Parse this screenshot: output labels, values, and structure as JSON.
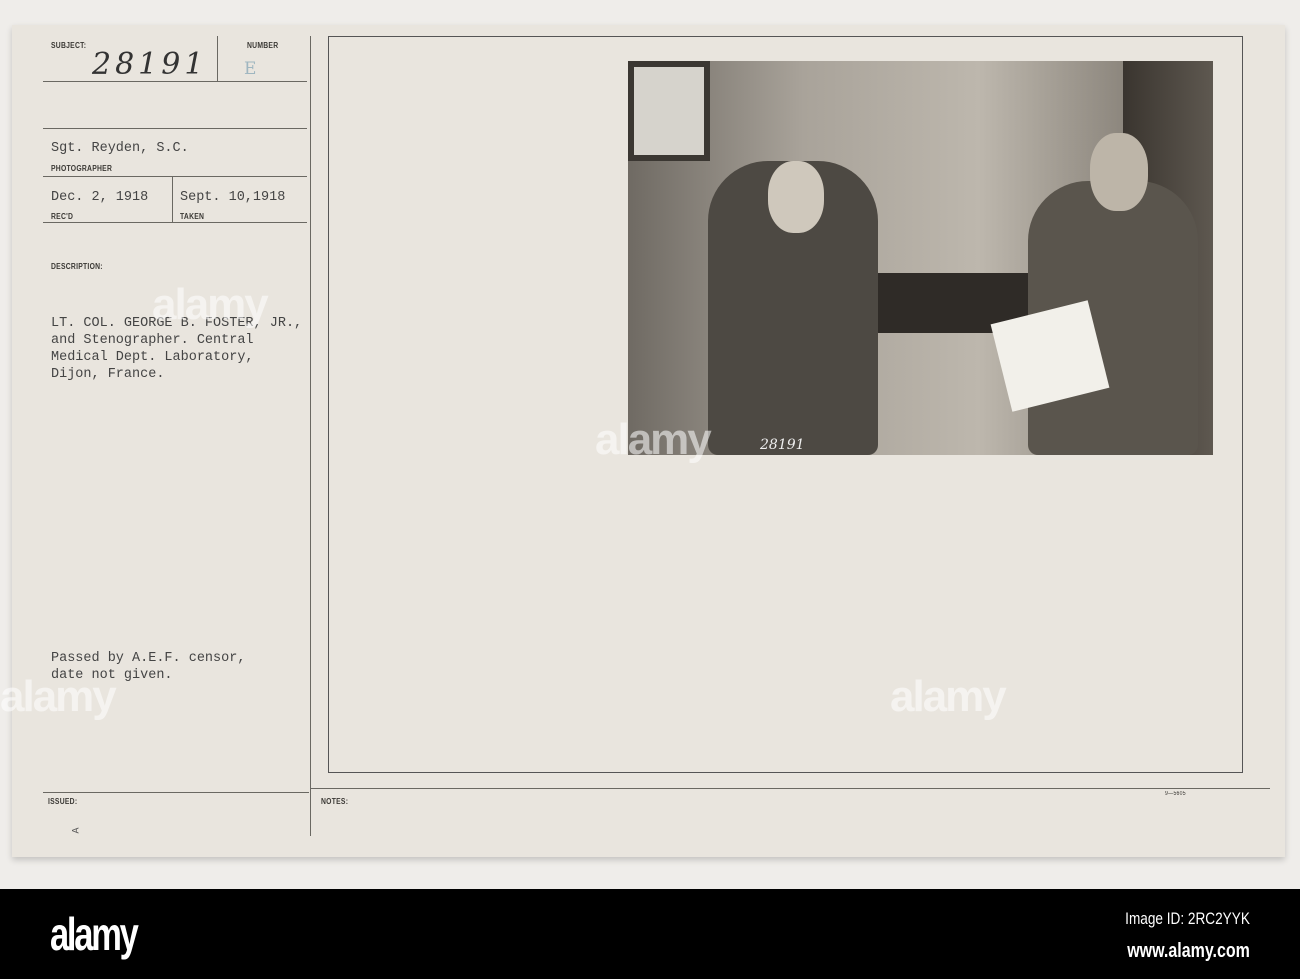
{
  "card": {
    "subject_label": "SUBJECT:",
    "subject_number": "28191",
    "number_label": "NUMBER",
    "number_value": "E",
    "photographer": "Sgt. Reyden, S.C.",
    "photographer_label": "PHOTOGRAPHER",
    "received": "Dec. 2, 1918",
    "received_label": "REC'D",
    "taken": "Sept. 10,1918",
    "taken_label": "TAKEN",
    "description_label": "DESCRIPTION:",
    "description": "LT. COL. GEORGE B. FOSTER, JR.,\nand Stenographer. Central\nMedical Dept. Laboratory,\nDijon, France.",
    "censor": "Passed by A.E.F. censor,\ndate not given.",
    "issued_label": "ISSUED:",
    "notes_label": "NOTES:",
    "form_code": "9—5605",
    "corner_mark": "A",
    "photo_number": "28191"
  },
  "watermark": "alamy",
  "footer": {
    "logo": "alamy",
    "image_id": "Image ID: 2RC2YYK",
    "url": "www.alamy.com"
  }
}
